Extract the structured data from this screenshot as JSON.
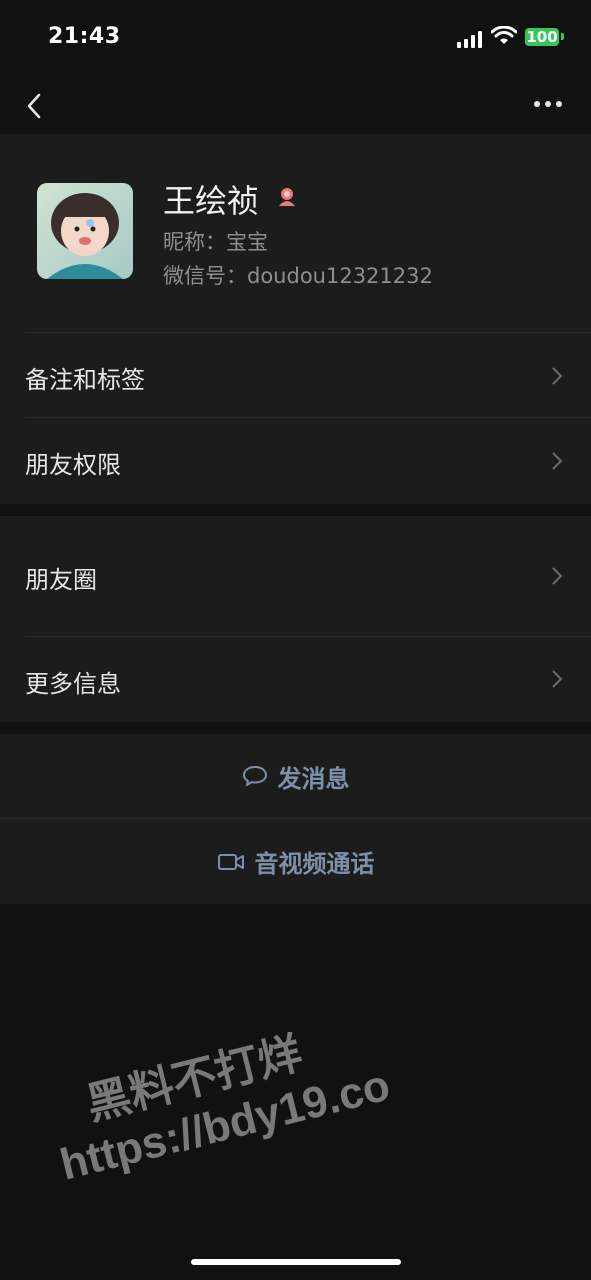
{
  "status": {
    "time": "21:43",
    "battery": "100"
  },
  "nav": {
    "back_icon": "chevron-left-icon",
    "more_icon": "more-icon"
  },
  "profile": {
    "name": "王绘祯",
    "nickname": "昵称：宝宝",
    "wechat_id": "微信号：doudou12321232",
    "gender_icon": "female-icon"
  },
  "menu": {
    "remark_tags": "备注和标签",
    "friend_permissions": "朋友权限",
    "moments": "朋友圈",
    "more_info": "更多信息"
  },
  "actions": {
    "send_message": "发消息",
    "video_call": "音视频通话"
  },
  "watermark": {
    "line1": "黑料不打烊",
    "line2": "https://bdy19.co"
  },
  "colors": {
    "background": "#111111",
    "card": "#1c1c1c",
    "action_text": "#7d90a9",
    "battery": "#35c759"
  }
}
